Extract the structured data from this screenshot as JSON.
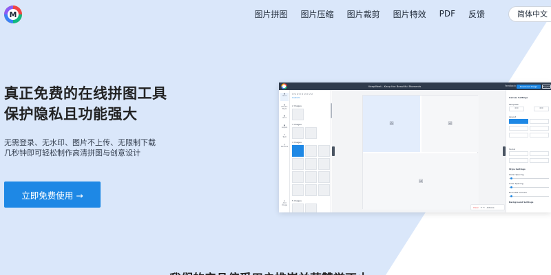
{
  "nav": {
    "logo_letter": "M",
    "links": [
      "图片拼图",
      "图片压缩",
      "图片裁剪",
      "图片特效",
      "PDF",
      "反馈"
    ],
    "language": "简体中文"
  },
  "hero": {
    "headline_line1": "真正免费的在线拼图工具",
    "headline_line2": "保护隐私且功能强大",
    "sub_line1": "无需登录、无水印、图片不上传、无限制下载",
    "sub_line2": "几秒钟即可轻松制作高清拼图与创意设计",
    "cta_label": "立即免费使用 →"
  },
  "section_title": "我们的产品倍受用户推崇并获赞誉不止",
  "preview": {
    "window_title": "KeepMeet - Keep the Beautiful Moments",
    "feedback": "Feedback",
    "download": "Download Image",
    "language": "English",
    "sidebar": [
      "Grid",
      "Mosaic Style",
      "Grid",
      "Layers",
      "Text",
      "Stickers",
      "Add Image"
    ],
    "panel_labels": [
      "2 Images",
      "3 Images",
      "4 Images",
      "5 Images"
    ],
    "tabs": "Custom",
    "canvas_settings": "Canvas Settings",
    "template": "Template",
    "width_value": "600",
    "height_value": "600",
    "settings_labels": [
      "Canvas Settings",
      "Template",
      "Layout",
      "Social",
      "Style Settings",
      "Outer Spacing",
      "Inner Spacing",
      "Rounded Corners",
      "Background Settings"
    ],
    "clear_label": "Clear",
    "bottom_label": "Actions"
  },
  "colors": {
    "accent": "#1e88e5",
    "hero_light": "#dce8fb"
  }
}
